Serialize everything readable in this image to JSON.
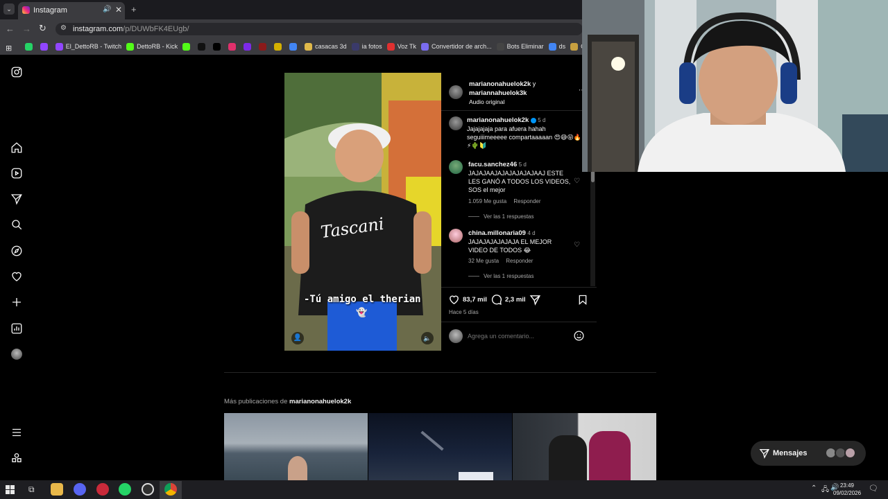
{
  "browser": {
    "tab_title": "Instagram",
    "url_domain": "instagram.com",
    "url_path": "/p/DUWbFK4EUgb/",
    "bookmarks": [
      {
        "label": "",
        "icon": "whatsapp-icon",
        "color": "#25d366"
      },
      {
        "label": "",
        "icon": "twitch-icon",
        "color": "#9146ff"
      },
      {
        "label": "El_DettoRB - Twitch",
        "icon": "twitch-icon",
        "color": "#9146ff"
      },
      {
        "label": "DettoRB - Kick",
        "icon": "kick-icon",
        "color": "#53fc18"
      },
      {
        "label": "",
        "icon": "kick-icon",
        "color": "#53fc18"
      },
      {
        "label": "",
        "icon": "tiktok-icon",
        "color": "#111111"
      },
      {
        "label": "",
        "icon": "x-icon",
        "color": "#000000"
      },
      {
        "label": "",
        "icon": "instagram-icon",
        "color": "#e1306c"
      },
      {
        "label": "",
        "icon": "canva-icon",
        "color": "#7d2ae8"
      },
      {
        "label": "",
        "icon": "red-dot-icon",
        "color": "#8b1a1a"
      },
      {
        "label": "",
        "icon": "star-icon",
        "color": "#d4b000"
      },
      {
        "label": "",
        "icon": "puzzle-icon",
        "color": "#4285f4"
      },
      {
        "label": "casacas 3d",
        "icon": "folder-icon",
        "color": "#e0b94a"
      },
      {
        "label": "ia fotos",
        "icon": "ai-icon",
        "color": "#3a3a6a"
      },
      {
        "label": "Voz Tk",
        "icon": "voice-icon",
        "color": "#e03030"
      },
      {
        "label": "Convertidor de arch...",
        "icon": "converter-icon",
        "color": "#7a6cf0"
      },
      {
        "label": "Bots Eliminar",
        "icon": "bot-icon",
        "color": "#444444"
      },
      {
        "label": "ds",
        "icon": "chrome-icon",
        "color": "#4285f4"
      },
      {
        "label": "Ca",
        "icon": "globe-icon",
        "color": "#c8a040"
      }
    ]
  },
  "post": {
    "header_user": "marianonahuelok2k",
    "header_and": "y",
    "header_user2": "mariannahuelok3k",
    "audio": "Audio original",
    "caption": {
      "user": "marianonahuelok2k",
      "time": "5 d",
      "text": "Jajajajaja  para afuera hahah seguiiimeeeee compartaaaaan 😍😅😝🔥⚡🌵🔰"
    },
    "comments": [
      {
        "user": "facu.sanchez46",
        "time": "5 d",
        "text": "JAJAJAAJAJAJAJAJAJAAJ ESTE LES GANÓ A TODOS LOS VIDEOS, SOS el mejor",
        "likes": "1.059 Me gusta",
        "reply": "Responder",
        "replies": "Ver las 1 respuestas"
      },
      {
        "user": "china.millonaria09",
        "time": "4 d",
        "text": "JAJAJAJAJAJAJA EL MEJOR VIDEO DE TODOS 😂",
        "likes": "32 Me gusta",
        "reply": "Responder",
        "replies": "Ver las 1 respuestas"
      }
    ],
    "likes": "83,7 mil",
    "comments_count": "2,3 mil",
    "ago": "Hace 5 días",
    "comment_placeholder": "Agrega un comentario...",
    "video_caption": "-Tú amigo el therian",
    "video_brand": "Tascani"
  },
  "more": {
    "prefix": "Más publicaciones de",
    "user": "marianonahuelok2k"
  },
  "messages": {
    "label": "Mensajes"
  },
  "taskbar": {
    "time": "23:49",
    "date": "09/02/2026"
  }
}
